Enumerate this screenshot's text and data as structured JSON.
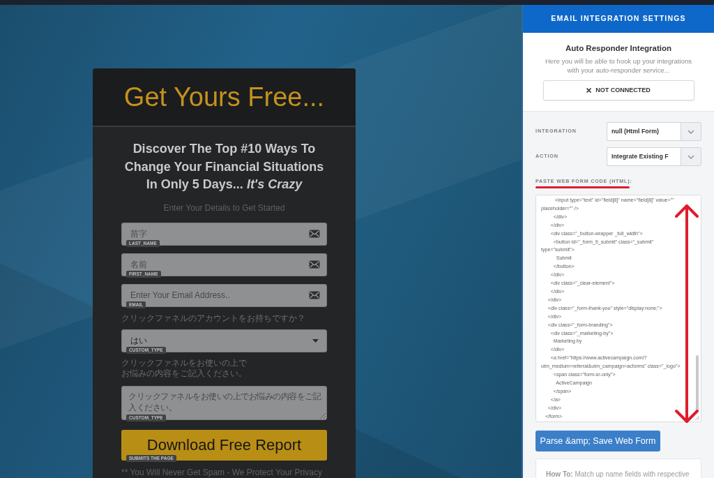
{
  "form_card": {
    "title": "Get Yours Free...",
    "headline": "Discover The Top #10 Ways To\nChange Your Financial Situations\nIn Only 5 Days... *It's Crazy*",
    "intro": "Enter Your Details to Get Started",
    "fields": [
      {
        "kind": "input",
        "placeholder": "苗字",
        "tag": "LAST_NAME"
      },
      {
        "kind": "input",
        "placeholder": "名前",
        "tag": "FIRST_NAME"
      },
      {
        "kind": "input",
        "placeholder": "Enter Your Email Address..",
        "tag": "EMAIL"
      },
      {
        "kind": "label",
        "text": "クリックファネルのアカウントをお持ちですか？"
      },
      {
        "kind": "select",
        "value": "はい",
        "tag": "CUSTOM_TYPE"
      },
      {
        "kind": "label",
        "text": "クリックファネルをお使いの上でお悩みの内容をご記入ください。"
      },
      {
        "kind": "textarea",
        "placeholder": "クリックファネルをお使いの上でお悩みの内容をご記入ください。",
        "tag": "CUSTOM_TYPE"
      }
    ],
    "submit": {
      "label": "Download Free Report",
      "tag": "SUBMITS THE PAGE"
    },
    "footnote": "** You Will Never Get Spam - We Protect Your Privacy"
  },
  "settings_panel": {
    "title": "EMAIL INTEGRATION SETTINGS",
    "section_title": "Auto Responder Integration",
    "description": "Here you will be able to hook up your integrations with your auto-responder service...",
    "status_button": "NOT CONNECTED",
    "selects": [
      {
        "label": "INTEGRATION",
        "value": "null (Html Form)"
      },
      {
        "label": "ACTION",
        "value": "Integrate Existing F"
      }
    ],
    "code_label": "PASTE WEB FORM CODE (HTML):",
    "code": "          <input type=\"text\" id=\"field[8]\" name=\"field[8]\" value=\"\"\nplaceholder=\"\" />\n         </div>\n       </div>\n       <div class=\"_button-wrapper _full_width\">\n         <button id=\"_form_9_submit\" class=\"_submit\"\ntype=\"submit\">\n           Submit\n         </button>\n       </div>\n       <div class=\"_clear-element\">\n       </div>\n     </div>\n     <div class=\"_form-thank-you\" style=\"display:none;\">\n     </div>\n     <div class=\"_form-branding\">\n       <div class=\"_marketing-by\">\n         Marketing by\n       </div>\n       <a href=\"https://www.activecampaign.com/?\nutm_medium=referral&utm_campaign=acforms\" class=\"_logo\">\n         <span class=\"form-sr-only\">\n           ActiveCampaign\n         </span>\n       </a>\n     </div>\n   </form>",
    "parse_button": "Parse &amp; Save Web Form",
    "how_to": "**How To:** Match up name fields with respective"
  }
}
